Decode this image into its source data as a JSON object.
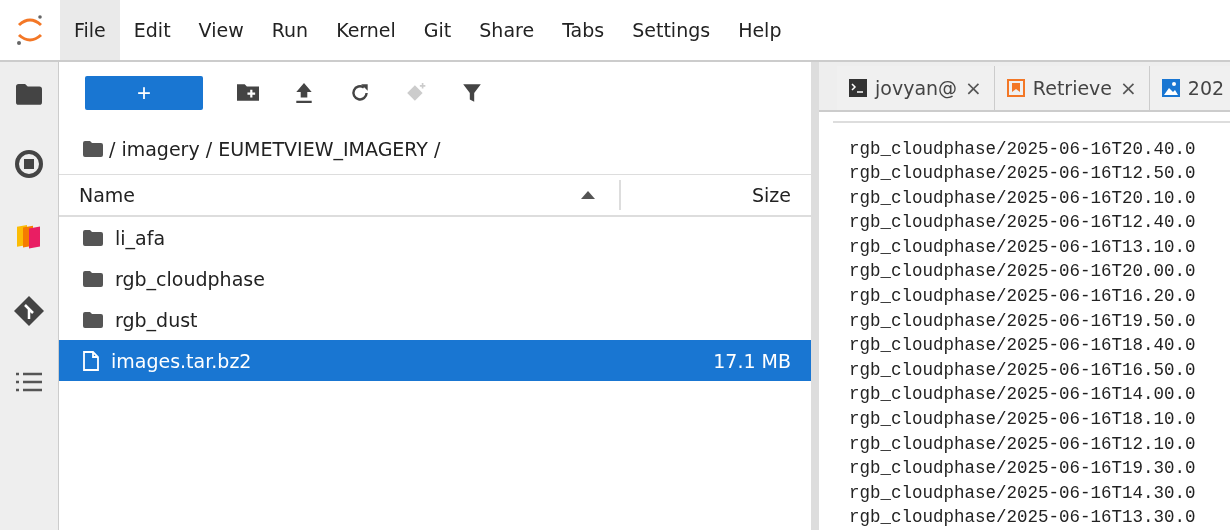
{
  "menu": [
    {
      "label": "File",
      "selected": true
    },
    {
      "label": "Edit",
      "selected": false
    },
    {
      "label": "View",
      "selected": false
    },
    {
      "label": "Run",
      "selected": false
    },
    {
      "label": "Kernel",
      "selected": false
    },
    {
      "label": "Git",
      "selected": false
    },
    {
      "label": "Share",
      "selected": false
    },
    {
      "label": "Tabs",
      "selected": false
    },
    {
      "label": "Settings",
      "selected": false
    },
    {
      "label": "Help",
      "selected": false
    }
  ],
  "toolbar": {
    "new_button": "+",
    "buttons": [
      {
        "kind": "new-folder",
        "disabled": false
      },
      {
        "kind": "upload",
        "disabled": false
      },
      {
        "kind": "refresh",
        "disabled": false
      },
      {
        "kind": "git-clone",
        "disabled": true
      },
      {
        "kind": "filter",
        "disabled": false
      }
    ]
  },
  "breadcrumb": "/ imagery / EUMETVIEW_IMAGERY /",
  "table": {
    "columns": [
      "Name",
      "Size"
    ],
    "rows": [
      {
        "kind": "folder",
        "name": "li_afa",
        "size": "",
        "selected": false
      },
      {
        "kind": "folder",
        "name": "rgb_cloudphase",
        "size": "",
        "selected": false
      },
      {
        "kind": "folder",
        "name": "rgb_dust",
        "size": "",
        "selected": false
      },
      {
        "kind": "file",
        "name": "images.tar.bz2",
        "size": "17.1 MB",
        "selected": true
      }
    ]
  },
  "tabs": [
    {
      "kind": "terminal",
      "label": "jovyan@",
      "close": "×"
    },
    {
      "kind": "notebook",
      "label": "Retrieve",
      "close": "×"
    },
    {
      "kind": "image",
      "label": "202"
    }
  ],
  "terminal_lines": [
    "rgb_cloudphase/2025-06-16T20.40.0",
    "rgb_cloudphase/2025-06-16T12.50.0",
    "rgb_cloudphase/2025-06-16T20.10.0",
    "rgb_cloudphase/2025-06-16T12.40.0",
    "rgb_cloudphase/2025-06-16T13.10.0",
    "rgb_cloudphase/2025-06-16T20.00.0",
    "rgb_cloudphase/2025-06-16T16.20.0",
    "rgb_cloudphase/2025-06-16T19.50.0",
    "rgb_cloudphase/2025-06-16T18.40.0",
    "rgb_cloudphase/2025-06-16T16.50.0",
    "rgb_cloudphase/2025-06-16T14.00.0",
    "rgb_cloudphase/2025-06-16T18.10.0",
    "rgb_cloudphase/2025-06-16T12.10.0",
    "rgb_cloudphase/2025-06-16T19.30.0",
    "rgb_cloudphase/2025-06-16T14.30.0",
    "rgb_cloudphase/2025-06-16T13.30.0"
  ]
}
